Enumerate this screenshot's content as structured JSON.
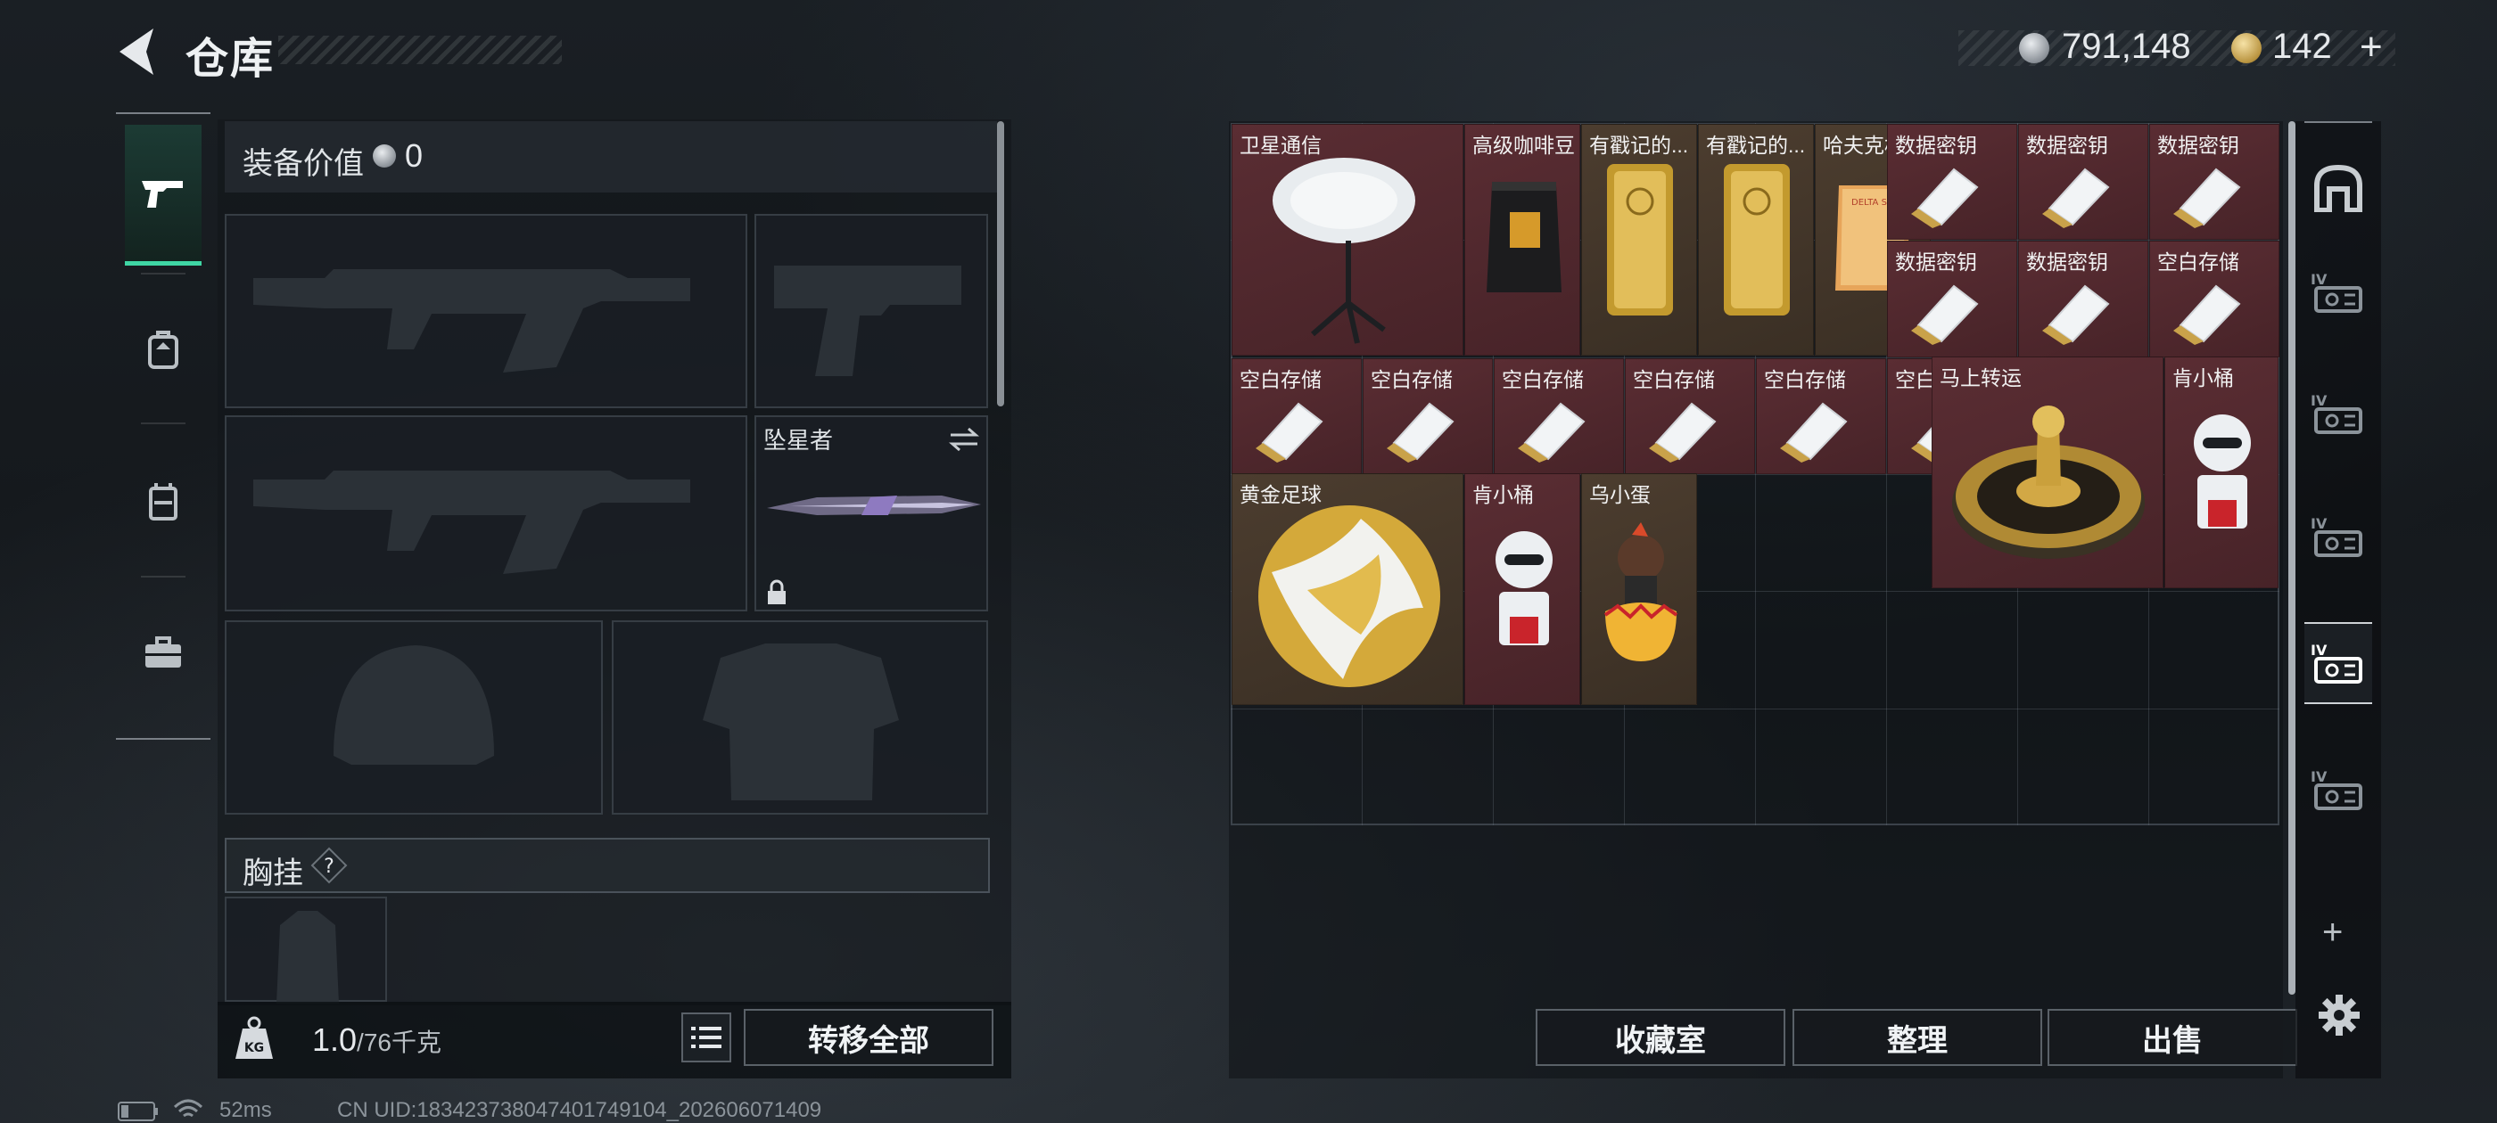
{
  "header": {
    "title": "仓库",
    "silver_value": "791,148",
    "gold_value": "142",
    "topup_label": "+"
  },
  "equipment": {
    "value_label": "装备价值",
    "value": "0",
    "melee_name": "坠星者",
    "chest_label": "胸挂",
    "help_label": "?",
    "weight_value": "1.0",
    "weight_unit": "/76千克",
    "weight_icon_label": "KG",
    "transfer_all": "转移全部"
  },
  "stash": {
    "items": {
      "satellite": "卫星通信",
      "coffee": "高级咖啡豆",
      "gold_bar_1": "有戳记的...",
      "gold_bar_2": "有戳记的...",
      "hafk_archive": "哈夫克档案",
      "data_key_1": "数据密钥",
      "data_key_2": "数据密钥",
      "data_key_3": "数据密钥",
      "data_key_4": "数据密钥",
      "data_key_5": "数据密钥",
      "blank_storage_1": "空白存储",
      "blank_storage_2": "空白存储",
      "blank_storage_3": "空白存储",
      "blank_storage_4": "空白存储",
      "blank_storage_5": "空白存储",
      "blank_storage_6": "空白存储",
      "blank_storage_7": "空白存储",
      "turntable": "马上转运",
      "kfc_bucket_1": "肯小桶",
      "golden_football": "黄金足球",
      "kfc_bucket_2": "肯小桶",
      "wu_egg": "乌小蛋"
    },
    "archive_cover": "DELTA SPECIAL ORDERS",
    "tab_badge": "IV",
    "collection_room": "收藏室",
    "organize": "整理",
    "sell": "出售",
    "add_tab": "+"
  },
  "status": {
    "ping": "52ms",
    "uid": "CN UID:18342373804740174910­4_202606071409"
  },
  "colors": {
    "accent_green": "#3fd6a4",
    "item_red": "#5a2d33",
    "item_gold": "#4c3d2f"
  }
}
